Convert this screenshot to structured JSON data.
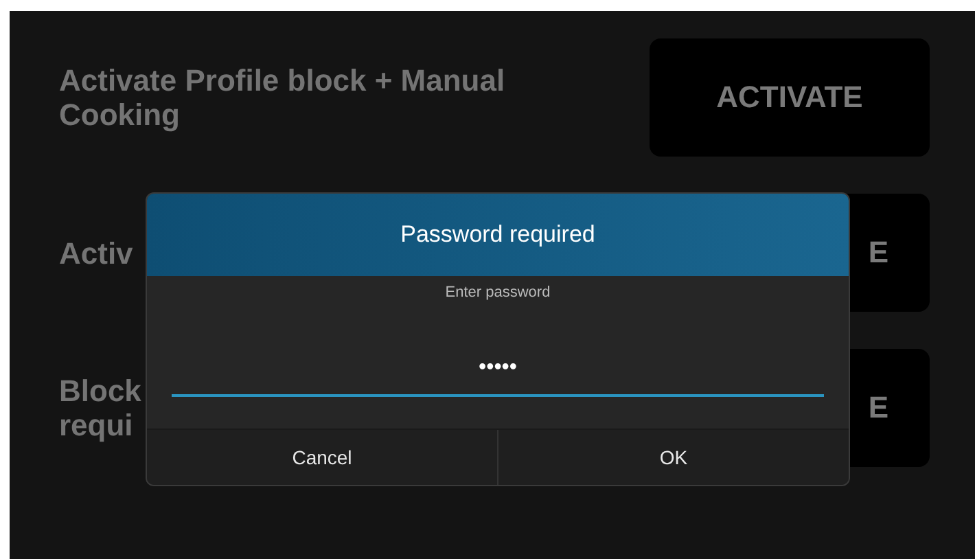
{
  "settings_rows": [
    {
      "label": "Activate Profile block + Manual Cooking",
      "button": "ACTIVATE"
    },
    {
      "label": "Activ",
      "button": "E"
    },
    {
      "label": "Block\nrequi",
      "button": "E"
    }
  ],
  "dialog": {
    "title": "Password required",
    "prompt": "Enter password",
    "password_value": "•••••",
    "buttons": [
      "Cancel",
      "OK"
    ]
  }
}
